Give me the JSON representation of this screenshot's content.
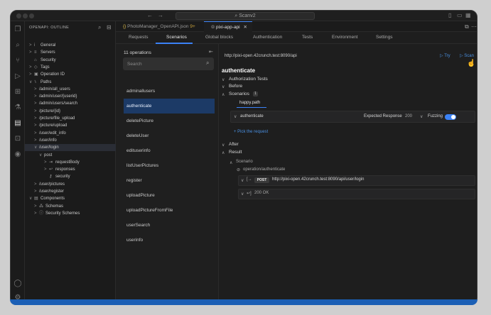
{
  "titlebar": {
    "command_center": "Scanv2",
    "nav_back": "←",
    "nav_forward": "→"
  },
  "explorer": {
    "title": "OPENAPI: OUTLINE",
    "tree": [
      {
        "label": "General",
        "indent": 1,
        "twisty": ">",
        "icon": "i"
      },
      {
        "label": "Servers",
        "indent": 1,
        "twisty": ">",
        "icon": "≡"
      },
      {
        "label": "Security",
        "indent": 1,
        "twisty": "",
        "icon": "⌂"
      },
      {
        "label": "Tags",
        "indent": 1,
        "twisty": ">",
        "icon": "◇"
      },
      {
        "label": "Operation ID",
        "indent": 1,
        "twisty": ">",
        "icon": "▣"
      },
      {
        "label": "Paths",
        "indent": 1,
        "twisty": "∨",
        "icon": "⑊"
      },
      {
        "label": "/admin/all_users",
        "indent": 2,
        "twisty": ">",
        "icon": ""
      },
      {
        "label": "/admin/user/{userid}",
        "indent": 2,
        "twisty": ">",
        "icon": ""
      },
      {
        "label": "/admin/users/search",
        "indent": 2,
        "twisty": ">",
        "icon": ""
      },
      {
        "label": "/picture/{id}",
        "indent": 2,
        "twisty": ">",
        "icon": ""
      },
      {
        "label": "/picture/file_upload",
        "indent": 2,
        "twisty": ">",
        "icon": ""
      },
      {
        "label": "/picture/upload",
        "indent": 2,
        "twisty": ">",
        "icon": ""
      },
      {
        "label": "/user/edit_info",
        "indent": 2,
        "twisty": ">",
        "icon": ""
      },
      {
        "label": "/user/info",
        "indent": 2,
        "twisty": ">",
        "icon": ""
      },
      {
        "label": "/user/login",
        "indent": 2,
        "twisty": "∨",
        "icon": "",
        "selected": true
      },
      {
        "label": "post",
        "indent": 3,
        "twisty": "∨",
        "icon": ""
      },
      {
        "label": "requestBody",
        "indent": 4,
        "twisty": ">",
        "icon": "⇥"
      },
      {
        "label": "responses",
        "indent": 4,
        "twisty": ">",
        "icon": "↩"
      },
      {
        "label": "security",
        "indent": 4,
        "twisty": "",
        "icon": "⚷"
      },
      {
        "label": "/user/pictures",
        "indent": 2,
        "twisty": ">",
        "icon": ""
      },
      {
        "label": "/user/register",
        "indent": 2,
        "twisty": ">",
        "icon": ""
      },
      {
        "label": "Components",
        "indent": 1,
        "twisty": "∨",
        "icon": "▤"
      },
      {
        "label": "Schemas",
        "indent": 2,
        "twisty": ">",
        "icon": "⁂"
      },
      {
        "label": "Security Schemes",
        "indent": 2,
        "twisty": ">",
        "icon": "ⓘ"
      }
    ]
  },
  "tabs": [
    {
      "label": "PhotoManager_OpenAPI.json",
      "suffix": "9+",
      "icon": "{}"
    },
    {
      "label": "pixi-app-api",
      "icon": "⦾",
      "active": true
    }
  ],
  "topnav": {
    "items": [
      "Requests",
      "Scenarios",
      "Global blocks",
      "Authentication",
      "Tests",
      "Environment",
      "Settings"
    ],
    "active": "Scenarios"
  },
  "operations": {
    "count_label": "11 operations",
    "search_placeholder": "Search",
    "items": [
      "adminallusers",
      "authenticate",
      "deletePicture",
      "deleteUser",
      "edituserinfo",
      "listUserPictures",
      "register",
      "uploadPicture",
      "uploadPictureFromFile",
      "userSearch",
      "userinfo"
    ],
    "selected": "authenticate"
  },
  "scenario": {
    "url": "http://pixi-open.42crunch.test:8090/api",
    "try_label": "Try",
    "scan_label": "Scan",
    "operation_title": "authenticate",
    "sections": {
      "authorization_tests": "Authorization Tests",
      "before": "Before",
      "scenarios": "Scenarios",
      "scenarios_count": "1",
      "after": "After",
      "result": "Result"
    },
    "happy_path_tab": "happy.path",
    "step": {
      "name": "authenticate",
      "expected_label": "Expected Response",
      "expected_value": "200",
      "fuzzing_label": "Fuzzing",
      "fuzzing_on": true
    },
    "pick_request": "+ Pick the request",
    "result": {
      "scenario_label": "Scenario",
      "operation_ref": "operation/authenticate",
      "method": "POST",
      "request_url": "http://pixi-open.42crunch.test:8090/api/user/login",
      "response": "200 OK"
    }
  },
  "colors": {
    "accent": "#3b82f6",
    "selected_op_bg": "#1c3a66",
    "status_bar": "#1b5fb5"
  }
}
